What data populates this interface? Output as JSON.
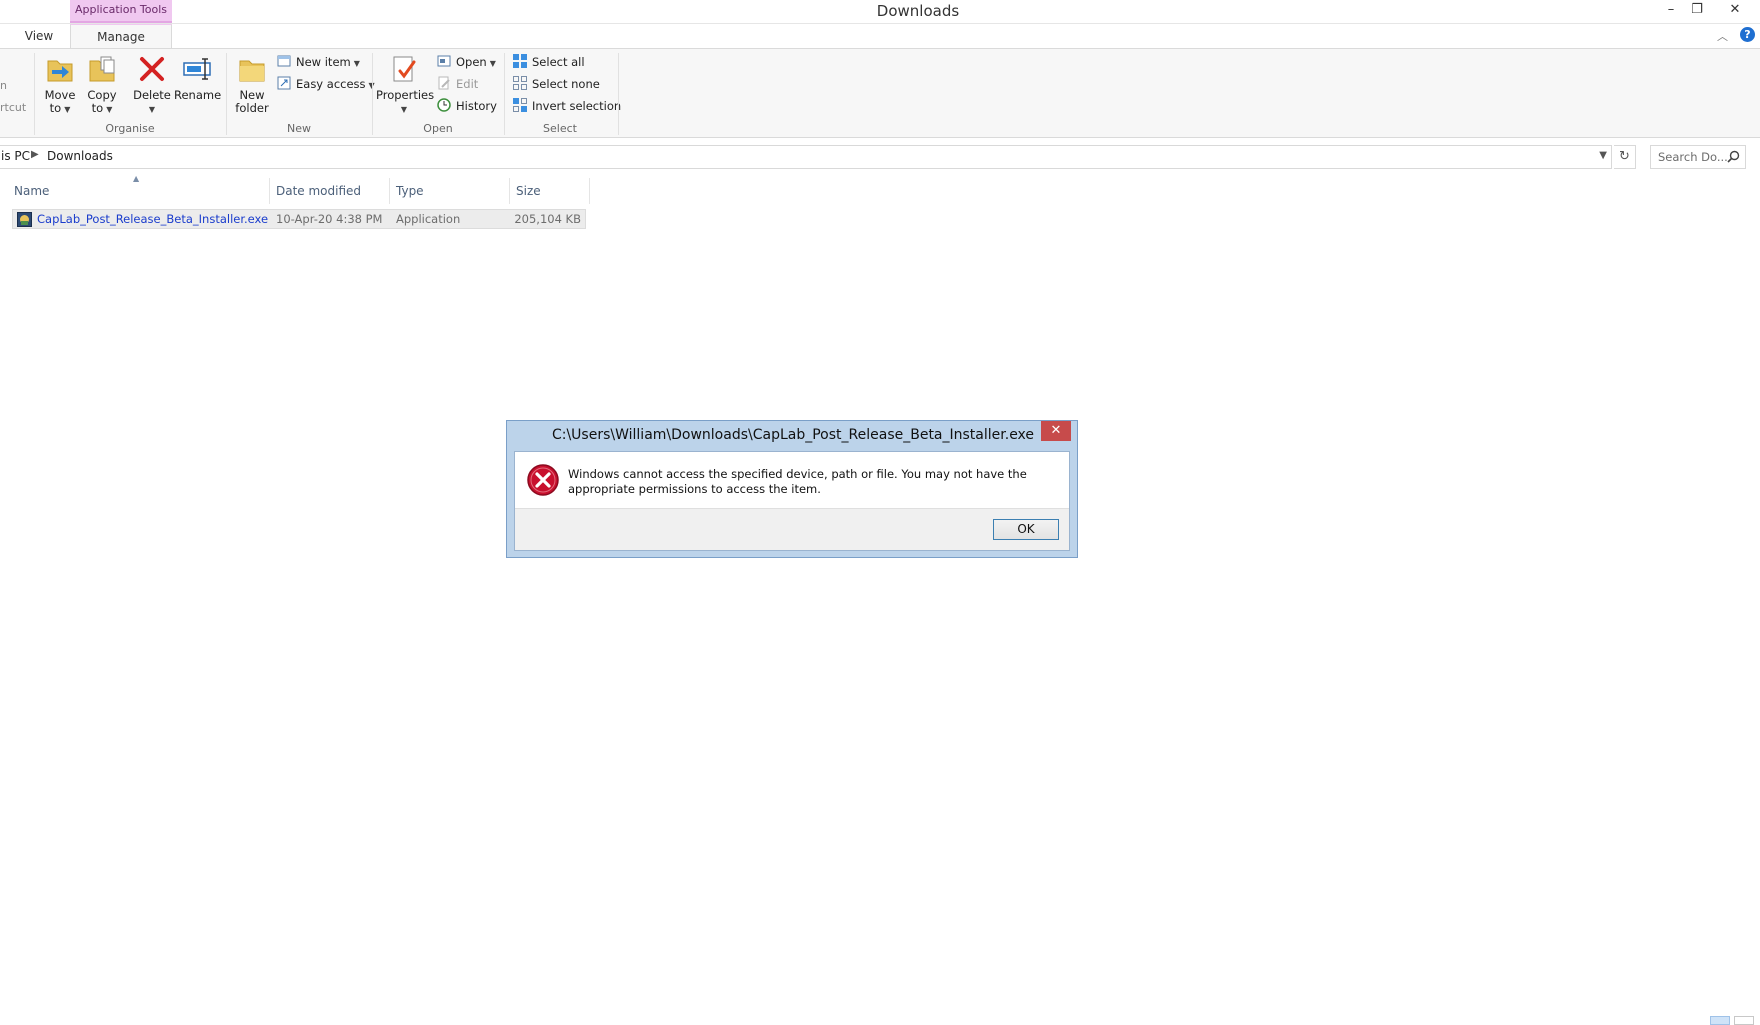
{
  "window": {
    "title": "Downloads",
    "contextual_group": "Application Tools",
    "controls": {
      "minimize": "–",
      "restore": "❐",
      "close": "✕"
    }
  },
  "tabs": [
    {
      "label": "View"
    },
    {
      "label": "Manage"
    }
  ],
  "ribbon": {
    "clipped_left_label": "rtcut",
    "clipped_left_top": "n",
    "organise": {
      "label": "Organise",
      "move_to": [
        "Move",
        "to"
      ],
      "copy_to": [
        "Copy",
        "to"
      ],
      "delete": "Delete",
      "rename": "Rename"
    },
    "new": {
      "label": "New",
      "new_folder": [
        "New",
        "folder"
      ],
      "new_item": "New item",
      "easy_access": "Easy access"
    },
    "open": {
      "label": "Open",
      "properties": "Properties",
      "open": "Open",
      "edit": "Edit",
      "history": "History"
    },
    "select": {
      "label": "Select",
      "select_all": "Select all",
      "select_none": "Select none",
      "invert_selection": "Invert selection"
    }
  },
  "address": {
    "crumbs": [
      "is PC",
      "Downloads"
    ],
    "search_placeholder": "Search Do..."
  },
  "columns": [
    "Name",
    "Date modified",
    "Type",
    "Size"
  ],
  "files": [
    {
      "name": "CapLab_Post_Release_Beta_Installer.exe",
      "date_modified": "10-Apr-20 4:38 PM",
      "type": "Application",
      "size": "205,104 KB"
    }
  ],
  "dialog": {
    "title": "C:\\Users\\William\\Downloads\\CapLab_Post_Release_Beta_Installer.exe",
    "message": "Windows cannot access the specified device, path or file. You may not have the appropriate permissions to access the item.",
    "ok_label": "OK"
  },
  "colors": {
    "accent": "#1a3ccc",
    "contextual": "#f0c8f0",
    "dialog_frame": "#bcd3ea",
    "close_red": "#c74b4b",
    "error_red": "#c8102e"
  }
}
